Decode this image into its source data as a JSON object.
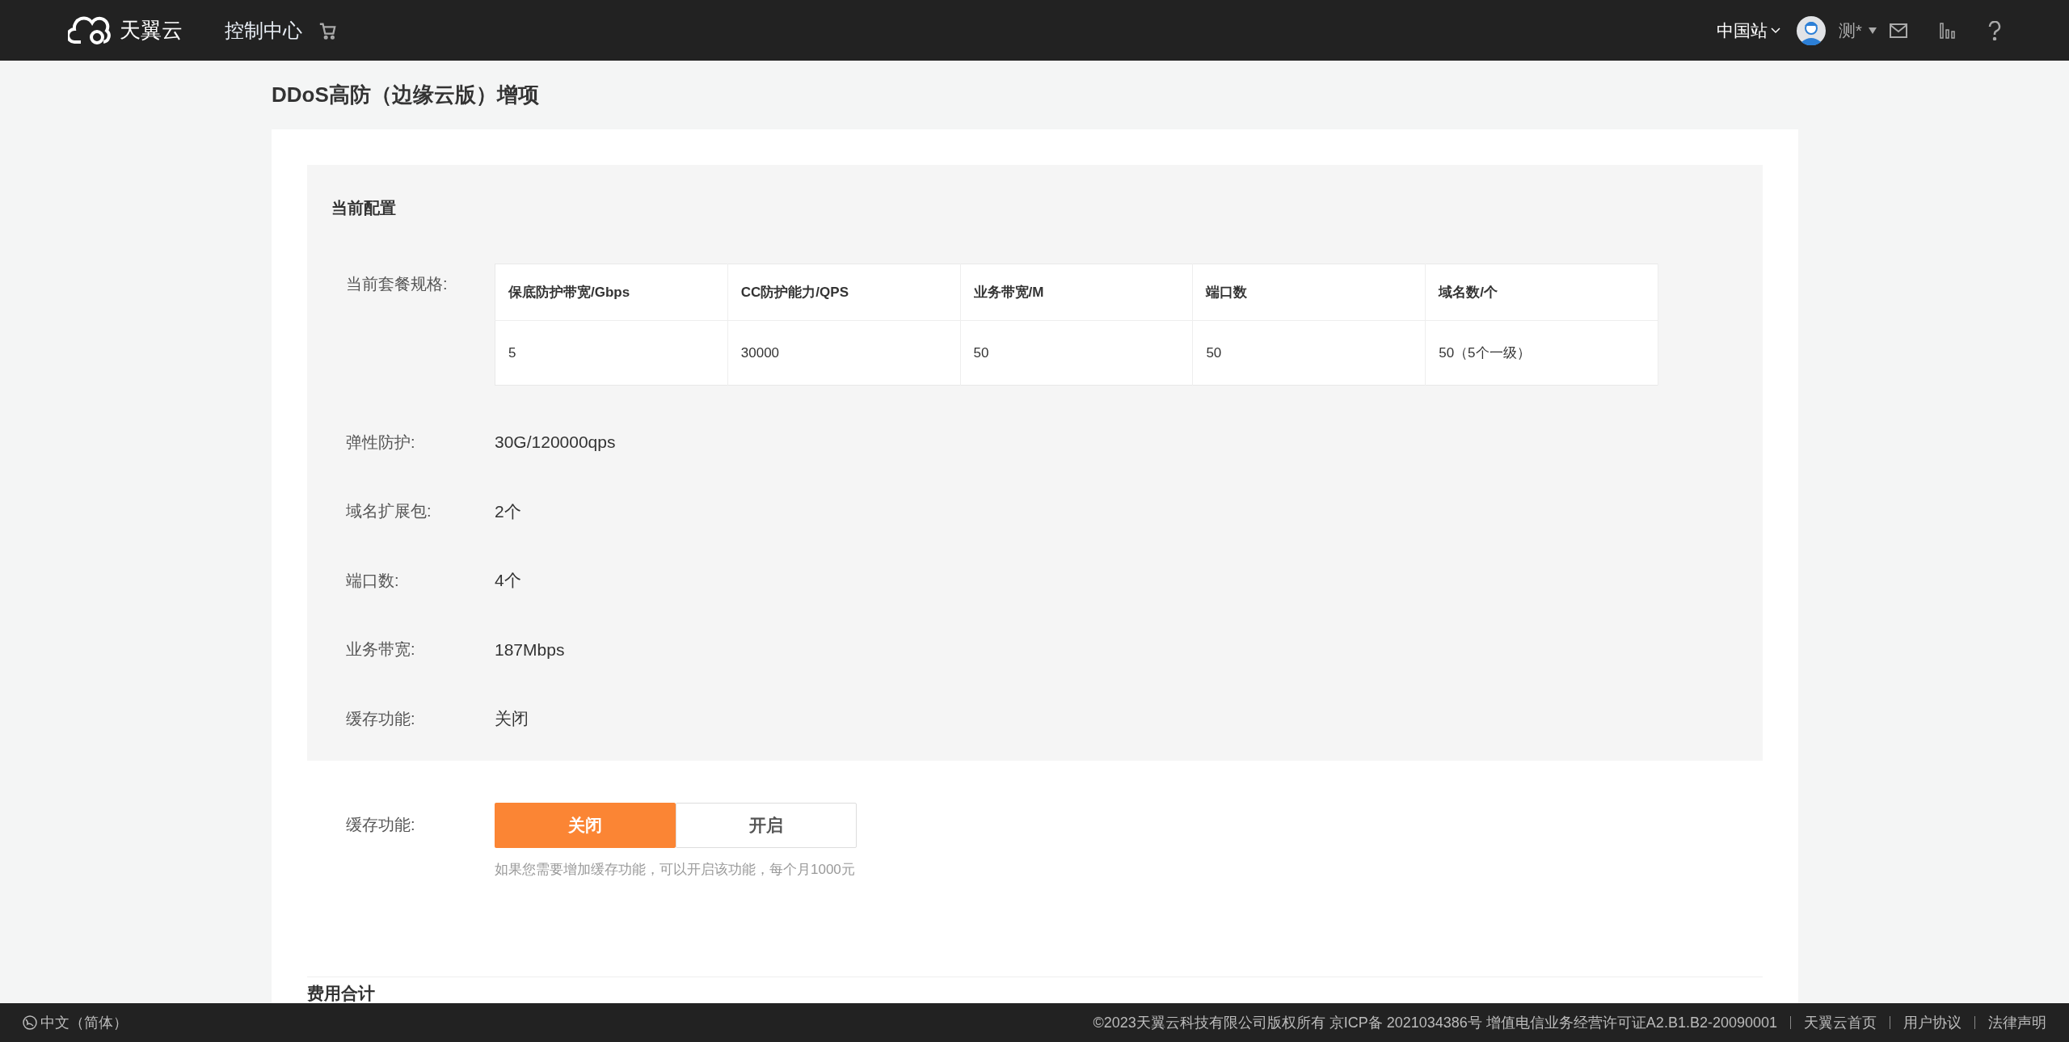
{
  "header": {
    "logo_text": "天翼云",
    "nav": "控制中心",
    "region": "中国站",
    "user": "测*"
  },
  "page_title": "DDoS高防（边缘云版）增项",
  "current_config": {
    "title": "当前配置",
    "spec_label": "当前套餐规格:",
    "table": {
      "columns": [
        "保底防护带宽/Gbps",
        "CC防护能力/QPS",
        "业务带宽/M",
        "端口数",
        "域名数/个"
      ],
      "rows": [
        [
          "5",
          "30000",
          "50",
          "50",
          "50（5个一级）"
        ]
      ]
    },
    "fields": [
      {
        "label": "弹性防护:",
        "value": "30G/120000qps"
      },
      {
        "label": "域名扩展包:",
        "value": "2个"
      },
      {
        "label": "端口数:",
        "value": "4个"
      },
      {
        "label": "业务带宽:",
        "value": "187Mbps"
      },
      {
        "label": "缓存功能:",
        "value": "关闭"
      }
    ]
  },
  "cache": {
    "label": "缓存功能:",
    "options": [
      {
        "label": "关闭",
        "selected": true
      },
      {
        "label": "开启",
        "selected": false
      }
    ],
    "hint": "如果您需要增加缓存功能，可以开启该功能，每个月1000元"
  },
  "cost_title": "费用合计",
  "footer": {
    "language": "中文（简体）",
    "copyright": "©2023天翼云科技有限公司版权所有 京ICP备 2021034386号 增值电信业务经营许可证A2.B1.B2-20090001",
    "links": [
      "天翼云首页",
      "用户协议",
      "法律声明"
    ]
  }
}
